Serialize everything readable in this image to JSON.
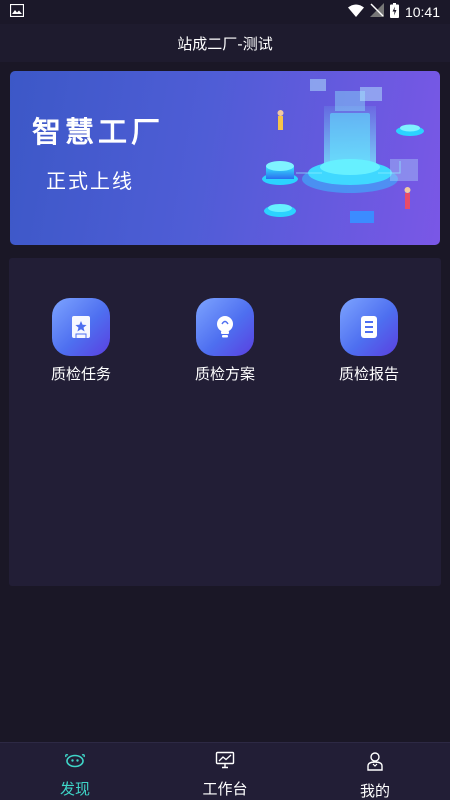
{
  "status_bar": {
    "time": "10:41",
    "icons": [
      "image-icon",
      "wifi-icon",
      "no-signal-icon",
      "battery-charging-icon"
    ]
  },
  "header": {
    "title": "站成二厂-测试"
  },
  "banner": {
    "title": "智慧工厂",
    "subtitle": "正式上线",
    "colors": {
      "start": "#3c58c7",
      "end": "#7a57e6"
    }
  },
  "features": [
    {
      "label": "质检任务",
      "icon": "bookmark-star-icon"
    },
    {
      "label": "质检方案",
      "icon": "lightbulb-icon"
    },
    {
      "label": "质检报告",
      "icon": "document-icon"
    }
  ],
  "bottom_nav": {
    "active_index": 0,
    "active_color": "#3fd5c8",
    "items": [
      {
        "label": "发现",
        "icon": "discover-icon"
      },
      {
        "label": "工作台",
        "icon": "monitor-chart-icon"
      },
      {
        "label": "我的",
        "icon": "person-icon"
      }
    ]
  }
}
